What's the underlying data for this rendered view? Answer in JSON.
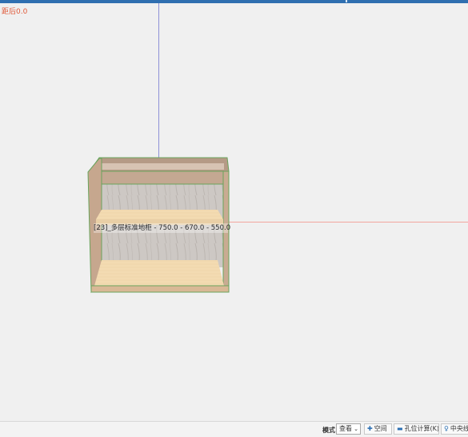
{
  "viewport": {
    "distance_label": "距后0.0",
    "cabinet_label": "[23]_多层标准地柜 - 750.0 - 670.0 - 550.0"
  },
  "statusbar": {
    "mode_label": "模式",
    "mode_value": "查看",
    "buttons": {
      "space": "空间",
      "hole_calc": "孔位计算(K)",
      "midline": "中央线"
    },
    "icons": {
      "mode_caret": "chevron-down-icon",
      "space": "plus-icon",
      "hole_calc": "ruler-icon",
      "midline": "bulb-icon"
    }
  },
  "colors": {
    "titlebar": "#2f6fb0",
    "distance_text": "#e05a3a",
    "axis_vertical": "#8e92d8",
    "axis_horizontal": "#f2a59e",
    "cabinet_edge": "#6aa35c",
    "panel_wood": "#c9a98f",
    "shelf_wood": "#f3dbb2",
    "back_panel": "#cfcac6"
  }
}
